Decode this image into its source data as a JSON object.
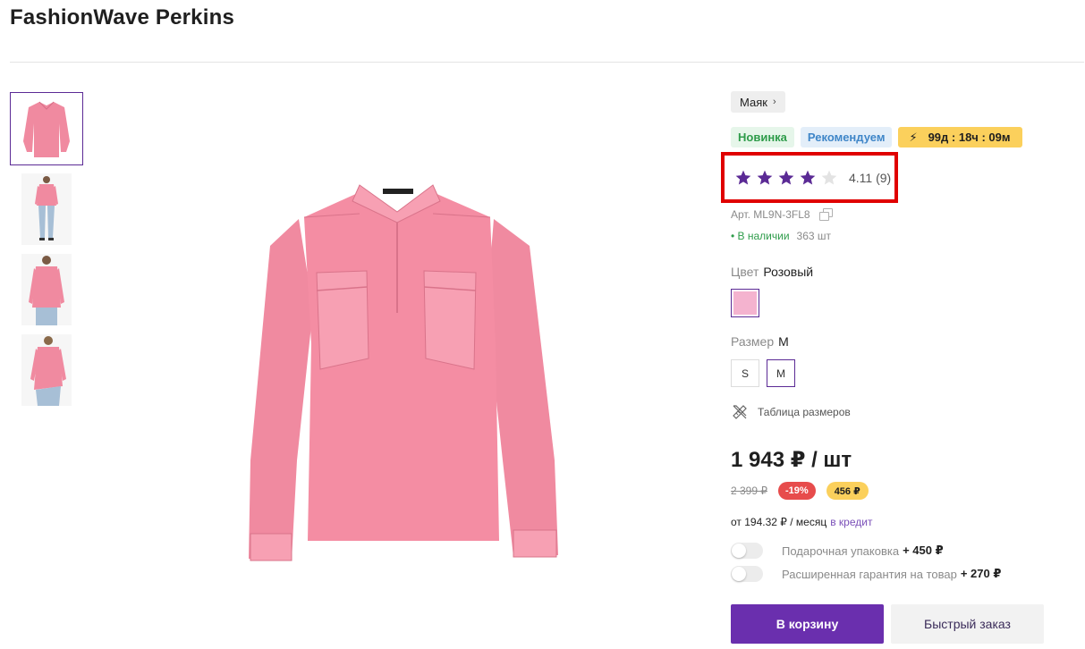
{
  "product": {
    "title": "FashionWave Perkins"
  },
  "thumbnails": [
    {
      "icon": "blouse-flat-thumbnail"
    },
    {
      "icon": "model-front-thumbnail"
    },
    {
      "icon": "model-half-thumbnail"
    },
    {
      "icon": "model-back-thumbnail"
    }
  ],
  "brand_chip": {
    "label": "Маяк",
    "chevron": "›"
  },
  "badges": {
    "new": "Новинка",
    "recommend": "Рекомендуем",
    "timer": "99д : 18ч : 09м",
    "timer_icon": "⚡"
  },
  "rating": {
    "stars_filled": 4,
    "stars_total": 5,
    "value_text": "4.11 (9)"
  },
  "article": {
    "label": "Арт. ML9N-3FL8"
  },
  "stock": {
    "status": "• В наличии",
    "quantity": "363 шт"
  },
  "color": {
    "label": "Цвет",
    "value": "Розовый",
    "swatch_hex": "#f4b3cf"
  },
  "size": {
    "label": "Размер",
    "value": "M",
    "options": [
      "S",
      "M"
    ]
  },
  "size_table": {
    "label": "Таблица размеров"
  },
  "price": {
    "current": "1 943 ₽ / шт",
    "old": "2 399 ₽",
    "discount": "-19%",
    "bonus": "456 ₽"
  },
  "credit": {
    "text": "от 194.32 ₽ / месяц",
    "link": "в кредит"
  },
  "options": {
    "gift_wrap": {
      "label": "Подарочная упаковка",
      "price": "+ 450 ₽"
    },
    "warranty": {
      "label": "Расширенная гарантия на товар",
      "price": "+ 270 ₽"
    }
  },
  "buttons": {
    "cart": "В корзину",
    "quick_order": "Быстрый заказ"
  },
  "colors": {
    "accent": "#6a2fae",
    "star": "#5b2a95",
    "highlight_border": "#e00000",
    "blouse": "#f0889e"
  }
}
